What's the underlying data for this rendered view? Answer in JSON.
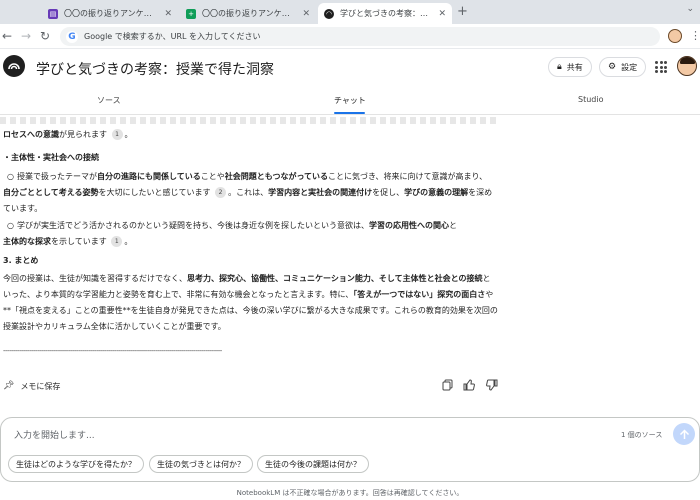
{
  "browser": {
    "tabs": [
      {
        "title": "〇〇の振り返りアンケート - Goo",
        "fav_color": "#673ab7"
      },
      {
        "title": "〇〇の振り返りアンケート（回答）",
        "fav_color": "#0f9d58"
      },
      {
        "title": "学びと気づきの考察：授業で得た",
        "fav_color": "#1f1f1f"
      }
    ],
    "active_tab": 2,
    "address_placeholder": "Google で検索するか、URL を入力してください"
  },
  "app": {
    "title": "学びと気づきの考察：授業で得た洞察",
    "share_label": "共有",
    "settings_label": "設定"
  },
  "tabs": {
    "sources": "ソース",
    "chat": "チャット",
    "studio": "Studio"
  },
  "content": {
    "line1_a": "ロセスへの意識",
    "line1_b": "が見られます",
    "cite_1": "1",
    "h_subject": "・主体性・実社会への接続",
    "b1_t1": "授業で扱ったテーマが",
    "b1_b1": "自分の進路にも関係している",
    "b1_t2": "ことや",
    "b1_b2": "社会問題ともつながっている",
    "b1_t3": "ことに気づき、将来に向けて意識が高まり、",
    "b1_b3": "自分ごととして考える姿勢",
    "b1_t4": "を大切にしたいと感じています",
    "cite_2": "2",
    "b1_t5": "。これは、",
    "b1_b4": "学習内容と実社会の関連付け",
    "b1_t6": "を促し、",
    "b1_b5": "学びの意義の理解",
    "b1_t7": "を深めています。",
    "b2_t1": "学びが実生活でどう活かされるのかという疑問を持ち、今後は身近な例を探したいという意欲は、",
    "b2_b1": "学習の応用性への関心",
    "b2_t2": "と",
    "b2_b2": "主体的な探求",
    "b2_t3": "を示しています",
    "cite_3": "1",
    "h_summary": "3. まとめ",
    "s_t1": "今回の授業は、生徒が知識を習得するだけでなく、",
    "s_b1": "思考力、探究心、協働性、コミュニケーション能力、そして主体性と社会との接続",
    "s_t2": "といった、より本質的な学習能力と姿勢を育む上で、非常に有効な機会となったと言えます。特に、",
    "s_b2": "「答えが一つではない」探究の面白さ",
    "s_t3": "や **「視点を変える」ことの重要性**を生徒自身が発見できた点は、今後の深い学びに繋がる大きな成果です。これらの教育的効果を次回の授業設計やカリキュラム全体に活かしていくことが重要です。",
    "rule": "------------------------------------------------------------------------------------------------------------"
  },
  "actions": {
    "save_memo": "メモに保存"
  },
  "composer": {
    "placeholder": "入力を開始します...",
    "source_count": "1 個のソース",
    "suggestions": [
      "生徒はどのような学びを得たか？",
      "生徒の気づきとは何か？",
      "生徒の今後の課題は何か？"
    ]
  },
  "footer": "NotebookLM は不正確な場合があります。回答は再確認してください。",
  "colors": {
    "accent": "#1a73e8",
    "send_bg": "#c2d7fb"
  }
}
